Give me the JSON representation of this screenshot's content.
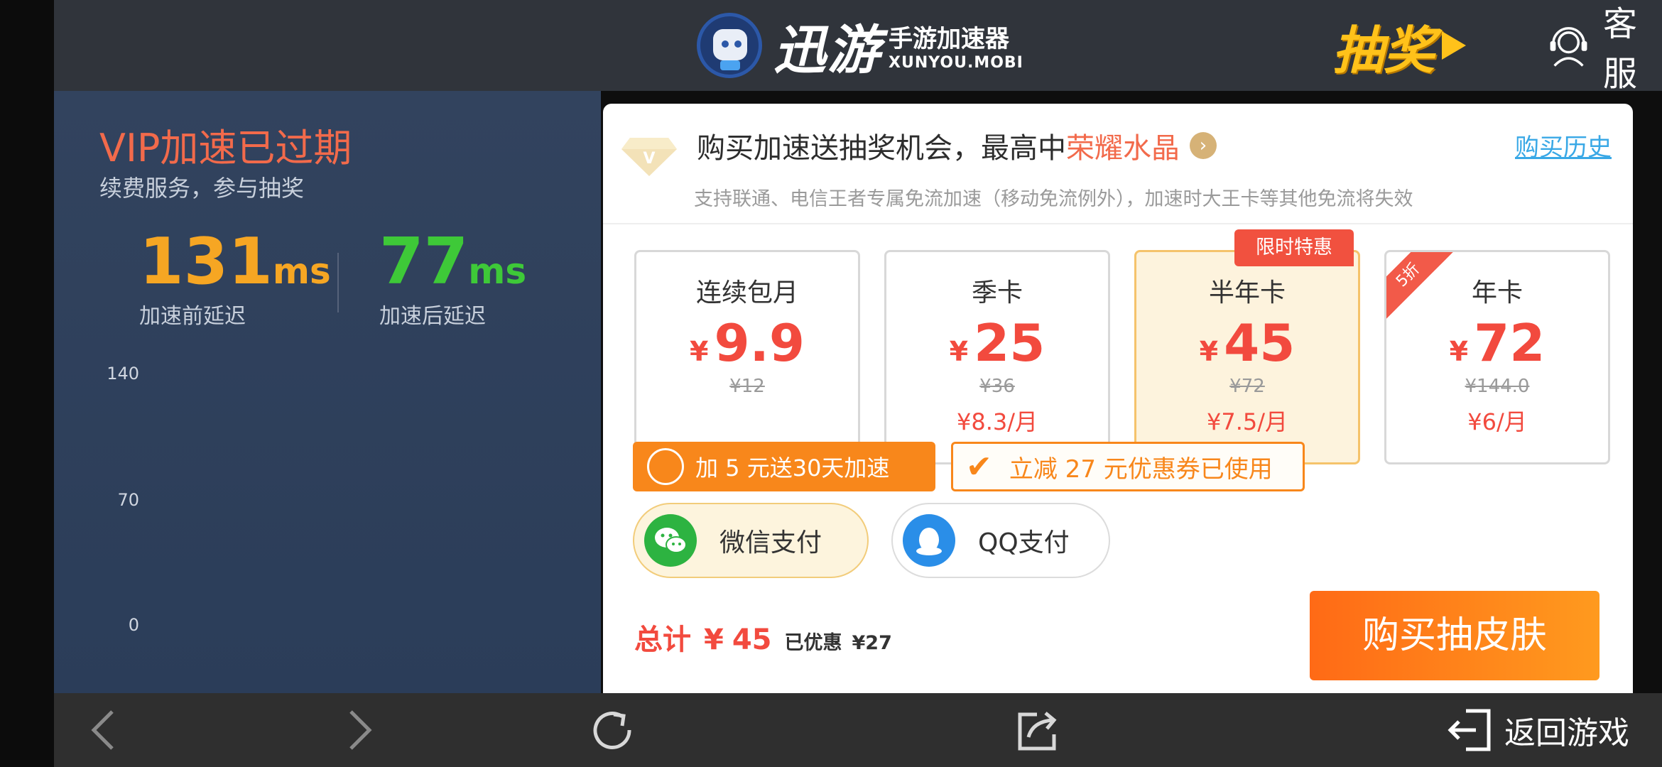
{
  "header": {
    "logo_main": "迅游",
    "logo_sub": "手游加速器",
    "logo_domain": "XUNYOU.MOBI",
    "lottery_label": "抽奖",
    "service_label": "客服"
  },
  "status": {
    "vip_title": "VIP加速已过期",
    "vip_subtitle": "续费服务，参与抽奖",
    "latency_before_value": "131",
    "latency_before_unit": "ms",
    "latency_before_label": "加速前延迟",
    "latency_after_value": "77",
    "latency_after_unit": "ms",
    "latency_after_label": "加速后延迟",
    "chart_ticks": [
      "140",
      "70",
      "0"
    ]
  },
  "purchase": {
    "promo_prefix": "购买加速送抽奖机会，最高中",
    "promo_highlight": "荣耀水晶",
    "promo_arrow": "›",
    "history_link": "购买历史",
    "note": "支持联通、电信王者专属免流加速（移动免流例外），加速时大王卡等其他免流将失效",
    "limited_tag": "限时特惠",
    "currency": "¥",
    "plans": [
      {
        "name": "连续包月",
        "price": "9.9",
        "original": "¥12",
        "per_month": ""
      },
      {
        "name": "季卡",
        "price": "25",
        "original": "¥36",
        "per_month": "¥8.3/月"
      },
      {
        "name": "半年卡",
        "price": "45",
        "original": "¥72",
        "per_month": "¥7.5/月",
        "selected": true
      },
      {
        "name": "年卡",
        "price": "72",
        "original": "¥144.0",
        "per_month": "¥6/月",
        "corner_badge": "5折"
      }
    ],
    "addon_option": "加 5 元送30天加速",
    "coupon_option": "立减 27 元优惠券已使用",
    "coupon_check": "✔",
    "payment": {
      "wechat": "微信支付",
      "qq": "QQ支付"
    },
    "total_label": "总计",
    "total_currency": "¥",
    "total_value": "45",
    "discount_label": "已优惠",
    "discount_value": "¥27",
    "buy_button": "购买抽皮肤"
  },
  "bottom_nav": {
    "return_label": "返回游戏"
  },
  "colors": {
    "accent_orange": "#f8871b",
    "price_red": "#f24a3e",
    "latency_before": "#f6a623",
    "latency_after": "#3ec938",
    "link_blue": "#39a8e6"
  }
}
